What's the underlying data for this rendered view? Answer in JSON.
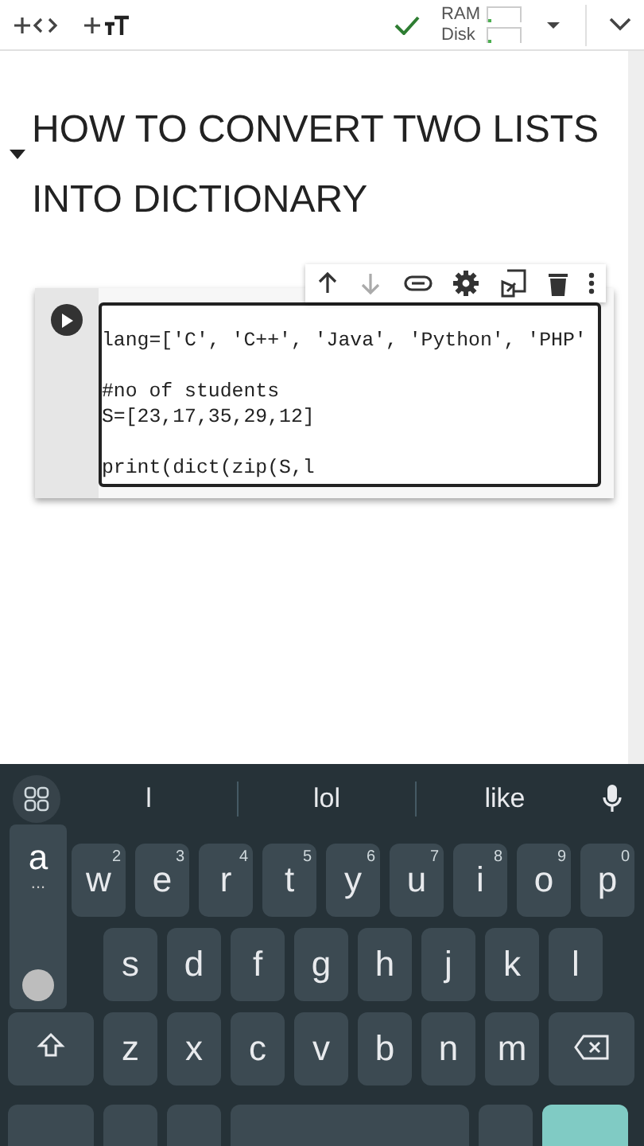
{
  "toolbar": {
    "resources": [
      {
        "label": "RAM",
        "level": 0.1
      },
      {
        "label": "Disk",
        "level": 0.1
      }
    ]
  },
  "heading": {
    "text": "HOW TO CONVERT TWO LISTS INTO DICTIONARY",
    "expanded": true
  },
  "code_cell": {
    "lines": [
      {
        "kind": "code",
        "text": "lang=['C', 'C++', 'Java', 'Python', 'PHP'"
      },
      {
        "kind": "blank"
      },
      {
        "kind": "code",
        "text": "#no of students"
      },
      {
        "kind": "code",
        "text": "S=[23,17,35,29,12]"
      },
      {
        "kind": "blank"
      },
      {
        "kind": "code",
        "text": "print(dict(zip(S,l"
      }
    ]
  },
  "keyboard": {
    "suggestions": [
      "l",
      "lol",
      "like"
    ],
    "rows": [
      [
        {
          "key": "w",
          "hint": "2"
        },
        {
          "key": "e",
          "hint": "3"
        },
        {
          "key": "r",
          "hint": "4"
        },
        {
          "key": "t",
          "hint": "5"
        },
        {
          "key": "y",
          "hint": "6"
        },
        {
          "key": "u",
          "hint": "7"
        },
        {
          "key": "i",
          "hint": "8"
        },
        {
          "key": "o",
          "hint": "9"
        },
        {
          "key": "p",
          "hint": "0"
        }
      ],
      [
        {
          "key": "s"
        },
        {
          "key": "d"
        },
        {
          "key": "f"
        },
        {
          "key": "g"
        },
        {
          "key": "h"
        },
        {
          "key": "j"
        },
        {
          "key": "k"
        },
        {
          "key": "l"
        }
      ],
      [
        {
          "key": "z"
        },
        {
          "key": "x"
        },
        {
          "key": "c"
        },
        {
          "key": "v"
        },
        {
          "key": "b"
        },
        {
          "key": "n"
        },
        {
          "key": "m"
        }
      ]
    ],
    "popup": {
      "key": "a",
      "more": "..."
    }
  }
}
